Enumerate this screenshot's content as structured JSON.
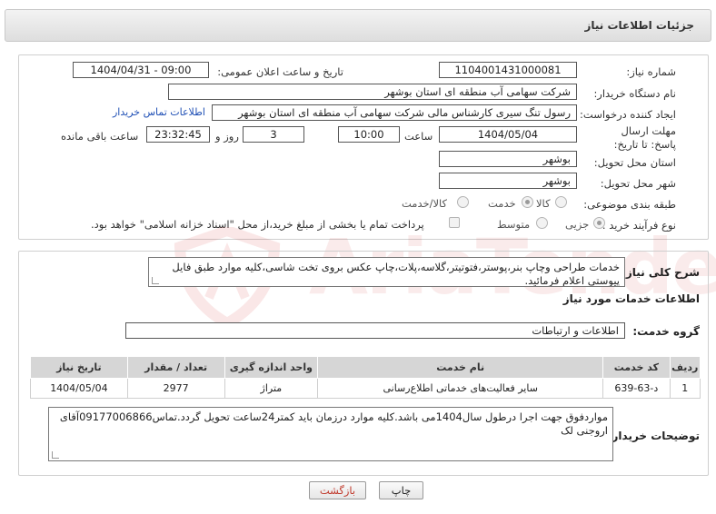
{
  "header": {
    "title": "جزئیات اطلاعات نیاز"
  },
  "labels": {
    "need_number": "شماره نیاز:",
    "announce_datetime": "تاریخ و ساعت اعلان عمومی:",
    "buyer_org": "نام دستگاه خریدار:",
    "requester": "ایجاد کننده درخواست:",
    "deadline": "مهلت ارسال پاسخ: تا تاریخ:",
    "hour": "ساعت",
    "day_and": "روز و",
    "hours_left": "ساعت باقی مانده",
    "province": "استان محل تحویل:",
    "city": "شهر محل تحویل:",
    "category": "طبقه بندی موضوعی:",
    "purchase_type": "نوع فرآیند خرید :",
    "general_desc": "شرح کلی نیاز:",
    "services_info": "اطلاعات خدمات مورد نیاز",
    "service_group": "گروه خدمت:",
    "buyer_notes": "توضیحات خریدار:"
  },
  "values": {
    "need_number": "1104001431000081",
    "announce_datetime": "1404/04/31 - 09:00",
    "buyer_org": "شرکت سهامی آب منطقه ای استان بوشهر",
    "requester": "رسول تنگ سیری کارشناس مالی شرکت سهامی آب منطقه ای استان بوشهر",
    "buyer_contact_link": "اطلاعات تماس خریدار",
    "deadline_date": "1404/05/04",
    "deadline_time": "10:00",
    "days_left": "3",
    "time_left": "23:32:45",
    "province": "بوشهر",
    "city": "بوشهر",
    "general_desc": "خدمات طراحی وچاپ بنر،پوستر،فتوتیتر،گلاسه،پلات،چاپ عکس بروی تخت شاسی،کلیه موارد طبق فایل پیوستی اعلام فرمائید.",
    "service_group": "اطلاعات و ارتباطات",
    "buyer_notes": "مواردفوق جهت اجرا درطول سال1404می باشد.کلیه موارد درزمان باید کمتر24ساعت تحویل گردد.تماس09177006866آقای اروجنی لک"
  },
  "category_options": [
    {
      "label": "کالا",
      "selected": false
    },
    {
      "label": "خدمت",
      "selected": true
    },
    {
      "label": "کالا/خدمت",
      "selected": false
    }
  ],
  "purchase_options": [
    {
      "label": "جزیی",
      "selected": true
    },
    {
      "label": "متوسط",
      "selected": false
    }
  ],
  "treasury_note": "پرداخت تمام یا بخشی از مبلغ خرید،از محل \"اسناد خزانه اسلامی\" خواهد بود.",
  "table": {
    "headers": [
      "ردیف",
      "کد خدمت",
      "نام خدمت",
      "واحد اندازه گیری",
      "تعداد / مقدار",
      "تاریخ نیاز"
    ],
    "rows": [
      [
        "1",
        "د-63-639",
        "سایر فعالیت‌های خدماتی اطلاع‌رسانی",
        "متراژ",
        "2977",
        "1404/05/04"
      ]
    ]
  },
  "buttons": {
    "print": "چاپ",
    "back": "بازگشت"
  },
  "watermark": {
    "text": "AriaTender.neT"
  },
  "colors": {
    "link": "#1f4fb5",
    "header_bg": "#e6e6e6",
    "table_header_bg": "#d6d6d6",
    "watermark": "#d23c3c"
  }
}
